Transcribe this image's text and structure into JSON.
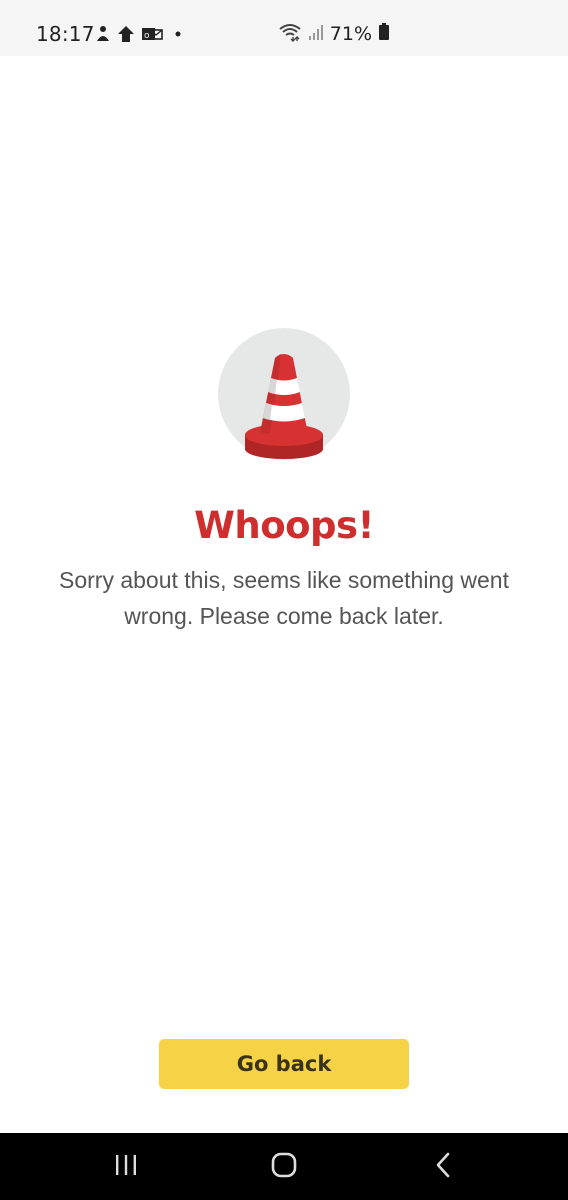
{
  "status_bar": {
    "time": "18:17",
    "battery_percent": "71%",
    "icons": [
      "notification-app-icon",
      "notification-app-icon",
      "mail-icon",
      "dot-icon",
      "wifi-icon",
      "signal-icon",
      "battery-icon"
    ]
  },
  "error": {
    "illustration": "traffic-cone-icon",
    "title": "Whoops!",
    "message": "Sorry about this, seems like something went wrong. Please come back later."
  },
  "actions": {
    "go_back_label": "Go back"
  },
  "nav_bar": {
    "buttons": [
      "recent-apps-icon",
      "home-icon",
      "back-icon"
    ]
  },
  "colors": {
    "title": "#cf2e2e",
    "button": "#f5d246",
    "cone_red": "#d63232",
    "cone_dark": "#b02626",
    "circle_bg": "#e6e7e7"
  }
}
